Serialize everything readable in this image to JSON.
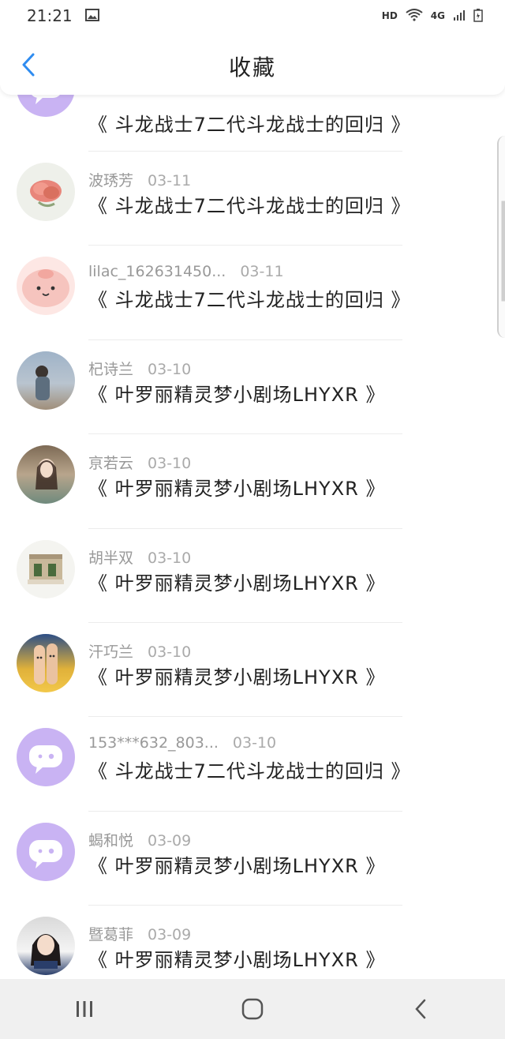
{
  "status_bar": {
    "time": "21:21",
    "network_label": "HD",
    "signal_label": "4G"
  },
  "header": {
    "title": "收藏"
  },
  "colors": {
    "accent": "#2f8cf0",
    "default_avatar": "#c9b3f3"
  },
  "items": [
    {
      "name": "",
      "date": "",
      "title": "《 斗龙战士7二代斗龙战士的回归 》",
      "avatar": "chat-bubble-avatar"
    },
    {
      "name": "波琇芳",
      "date": "03-11",
      "title": "《 斗龙战士7二代斗龙战士的回归 》",
      "avatar": "rose-avatar"
    },
    {
      "name": "lilac_162631450...",
      "date": "03-11",
      "title": "《 斗龙战士7二代斗龙战士的回归 》",
      "avatar": "pink-blob-avatar"
    },
    {
      "name": "杞诗兰",
      "date": "03-10",
      "title": "《 叶罗丽精灵梦小剧场LHYXR 》",
      "avatar": "photo-avatar"
    },
    {
      "name": "亰若云",
      "date": "03-10",
      "title": "《 叶罗丽精灵梦小剧场LHYXR 》",
      "avatar": "photo-avatar"
    },
    {
      "name": "胡半双",
      "date": "03-10",
      "title": "《 叶罗丽精灵梦小剧场LHYXR 》",
      "avatar": "figurine-avatar"
    },
    {
      "name": "汗巧兰",
      "date": "03-10",
      "title": "《 叶罗丽精灵梦小剧场LHYXR 》",
      "avatar": "fingers-avatar"
    },
    {
      "name": "153***632_803...",
      "date": "03-10",
      "title": "《 斗龙战士7二代斗龙战士的回归 》",
      "avatar": "chat-bubble-avatar"
    },
    {
      "name": "蝎和悦",
      "date": "03-09",
      "title": "《 叶罗丽精灵梦小剧场LHYXR 》",
      "avatar": "chat-bubble-avatar"
    },
    {
      "name": "暨葛菲",
      "date": "03-09",
      "title": "《 叶罗丽精灵梦小剧场LHYXR 》",
      "avatar": "photo-avatar"
    }
  ],
  "nav": {
    "recent_icon": "recent-apps-icon",
    "home_icon": "home-icon",
    "back_icon": "back-icon"
  }
}
